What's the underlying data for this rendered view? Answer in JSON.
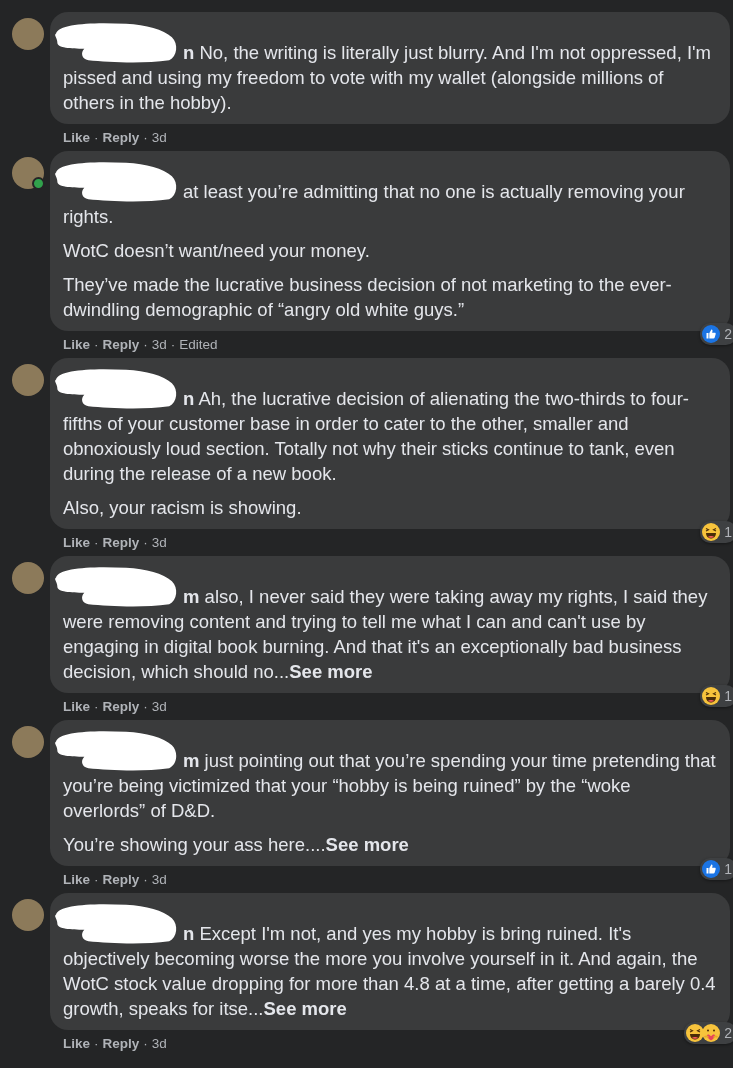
{
  "separator": "·",
  "comments": [
    {
      "online": false,
      "name_fragment": "n",
      "paragraphs": [
        {
          "text": "No, the writing is literally just blurry. And I'm not oppressed, I'm pissed and using my freedom to vote with my wallet (alongside millions of others in the hobby)."
        }
      ],
      "actions": [
        "Like",
        "Reply",
        "3d"
      ]
    },
    {
      "online": true,
      "paragraphs": [
        {
          "text": "at least you’re admitting that no one is actually removing your rights."
        },
        {
          "text": "WotC doesn’t want/need your money."
        },
        {
          "text": "They’ve made the lucrative business decision of not marketing to the ever-dwindling demographic of “angry old white guys.”"
        }
      ],
      "actions": [
        "Like",
        "Reply",
        "3d",
        "Edited"
      ],
      "reactions": {
        "icons": [
          {
            "kind": "like"
          }
        ],
        "count": "2"
      }
    },
    {
      "online": false,
      "name_fragment": "n",
      "paragraphs": [
        {
          "text": "Ah, the lucrative decision of alienating the two-thirds to four-fifths of your customer base in order to cater to the other, smaller and obnoxiously loud section. Totally not why their sticks continue to tank, even during the release of a new book."
        },
        {
          "text": "Also, your racism is showing."
        }
      ],
      "actions": [
        "Like",
        "Reply",
        "3d"
      ],
      "reactions": {
        "icons": [
          {
            "kind": "haha"
          }
        ],
        "count": "1"
      }
    },
    {
      "online": false,
      "name_fragment": "m",
      "paragraphs": [
        {
          "text": "also, I never said they were taking away my rights, I said they were removing content and trying to tell me what I can and can't use by engaging in digital book burning. And that it's an exceptionally bad business decision, which should no...",
          "see_more": "See more"
        }
      ],
      "actions": [
        "Like",
        "Reply",
        "3d"
      ],
      "reactions": {
        "icons": [
          {
            "kind": "haha"
          }
        ],
        "count": "1"
      }
    },
    {
      "online": false,
      "name_fragment": "m",
      "paragraphs": [
        {
          "text": "just pointing out that you’re spending your time pretending that you’re being victimized that your “hobby is being ruined” by the “woke overlords” of D&D."
        },
        {
          "text": "You’re showing your ass here....",
          "see_more": "See more"
        }
      ],
      "actions": [
        "Like",
        "Reply",
        "3d"
      ],
      "reactions": {
        "icons": [
          {
            "kind": "like"
          }
        ],
        "count": "1"
      }
    },
    {
      "online": false,
      "name_fragment": "n",
      "paragraphs": [
        {
          "text": "Except I'm not, and yes my hobby is bring ruined. It's objectively becoming worse the more you involve yourself in it. And again, the WotC stock value dropping for more than 4.8 at a time, after getting a barely 0.4 growth, speaks for itse...",
          "see_more": "See more"
        }
      ],
      "actions": [
        "Like",
        "Reply",
        "3d"
      ],
      "reactions": {
        "icons": [
          {
            "kind": "haha"
          },
          {
            "kind": "care"
          }
        ],
        "count": "2"
      }
    }
  ]
}
